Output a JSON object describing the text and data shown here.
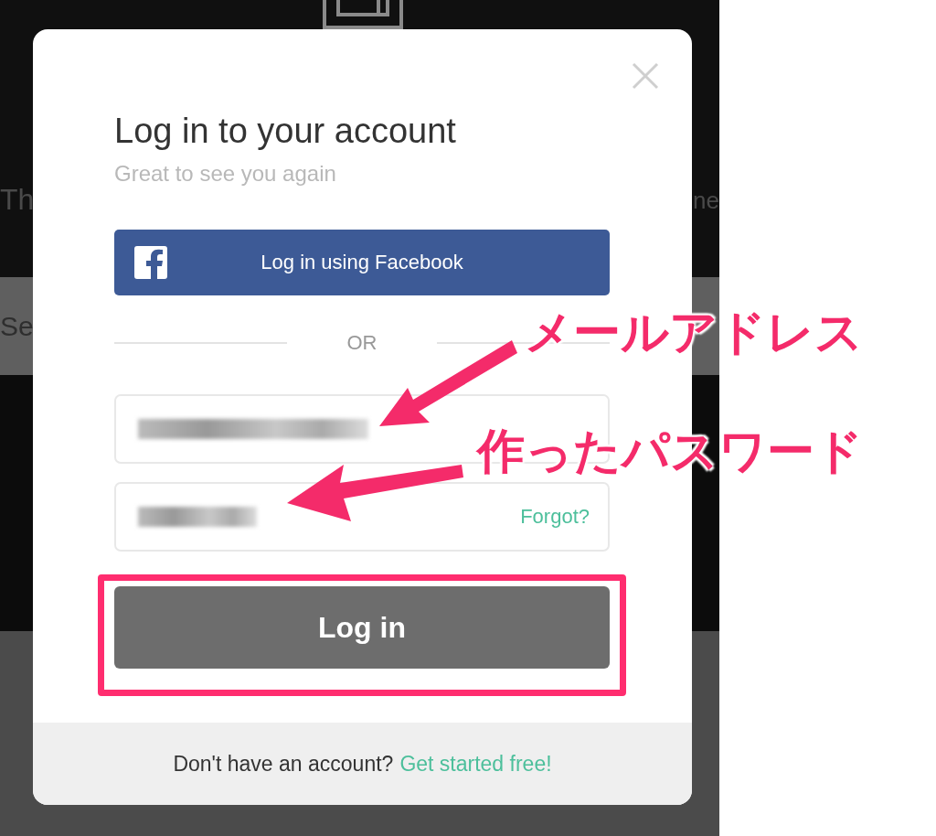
{
  "background": {
    "fragments": [
      "Th",
      "ne",
      "Se"
    ]
  },
  "dialog": {
    "title": "Log in to your account",
    "subtitle": "Great to see you again",
    "facebook_button": "Log in using Facebook",
    "divider": "OR",
    "email_field": {
      "value_redacted": true
    },
    "password_field": {
      "value_redacted": true,
      "link": "Forgot?"
    },
    "login_button": "Log in",
    "footer": {
      "text": "Don't have an account?",
      "link": "Get started free!"
    }
  },
  "annotations": [
    {
      "label": "メールアドレス"
    },
    {
      "label": "作ったパスワード"
    }
  ]
}
